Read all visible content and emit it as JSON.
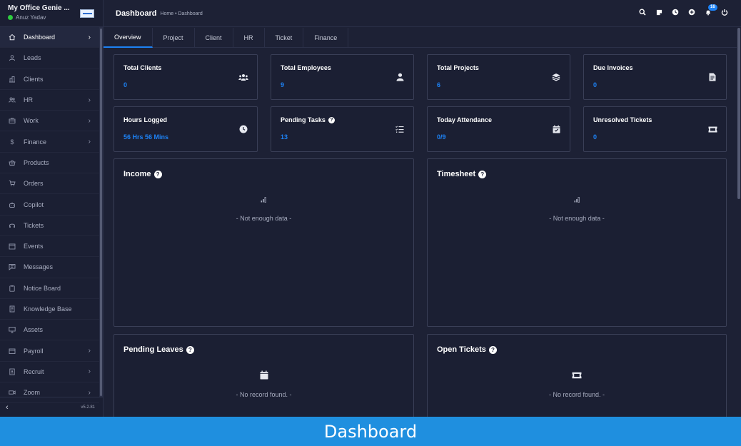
{
  "app": {
    "name": "My Office Genie ...",
    "user": "Anuz Yadav",
    "version": "v5.2.81"
  },
  "sidebar": {
    "items": [
      {
        "label": "Dashboard",
        "icon": "home-icon",
        "chevron": true,
        "active": true
      },
      {
        "label": "Leads",
        "icon": "user-icon",
        "chevron": false
      },
      {
        "label": "Clients",
        "icon": "building-icon",
        "chevron": false
      },
      {
        "label": "HR",
        "icon": "people-icon",
        "chevron": true
      },
      {
        "label": "Work",
        "icon": "briefcase-icon",
        "chevron": true
      },
      {
        "label": "Finance",
        "icon": "dollar-icon",
        "chevron": true
      },
      {
        "label": "Products",
        "icon": "basket-icon",
        "chevron": false
      },
      {
        "label": "Orders",
        "icon": "cart-icon",
        "chevron": false
      },
      {
        "label": "Copilot",
        "icon": "robot-icon",
        "chevron": false
      },
      {
        "label": "Tickets",
        "icon": "headset-icon",
        "chevron": false
      },
      {
        "label": "Events",
        "icon": "calendar-icon",
        "chevron": false
      },
      {
        "label": "Messages",
        "icon": "message-icon",
        "chevron": false
      },
      {
        "label": "Notice Board",
        "icon": "clipboard-icon",
        "chevron": false
      },
      {
        "label": "Knowledge Base",
        "icon": "book-icon",
        "chevron": false
      },
      {
        "label": "Assets",
        "icon": "monitor-icon",
        "chevron": false
      },
      {
        "label": "Payroll",
        "icon": "wallet-icon",
        "chevron": true
      },
      {
        "label": "Recruit",
        "icon": "badge-icon",
        "chevron": true
      },
      {
        "label": "Zoom",
        "icon": "video-icon",
        "chevron": true
      }
    ]
  },
  "header": {
    "title": "Dashboard",
    "breadcrumb": "Home • Dashboard",
    "notification_count": "16"
  },
  "tabs": [
    "Overview",
    "Project",
    "Client",
    "HR",
    "Ticket",
    "Finance"
  ],
  "stats": [
    {
      "label": "Total Clients",
      "value": "0",
      "icon": "users-icon"
    },
    {
      "label": "Total Employees",
      "value": "9",
      "icon": "user-icon"
    },
    {
      "label": "Total Projects",
      "value": "6",
      "icon": "layers-icon"
    },
    {
      "label": "Due Invoices",
      "value": "0",
      "icon": "file-invoice-icon"
    },
    {
      "label": "Hours Logged",
      "value": "56 Hrs 56 Mins",
      "icon": "clock-icon"
    },
    {
      "label": "Pending Tasks",
      "value": "13",
      "icon": "tasks-icon",
      "help": true
    },
    {
      "label": "Today Attendance",
      "value": "0/9",
      "icon": "calendar-check-icon"
    },
    {
      "label": "Unresolved Tickets",
      "value": "0",
      "icon": "ticket-icon"
    }
  ],
  "panels": {
    "income": {
      "title": "Income",
      "empty": "- Not enough data -"
    },
    "timesheet": {
      "title": "Timesheet",
      "empty": "- Not enough data -"
    },
    "pending_leaves": {
      "title": "Pending Leaves",
      "empty": "- No record found. -"
    },
    "open_tickets": {
      "title": "Open Tickets",
      "empty": "- No record found. -"
    }
  },
  "caption": "Dashboard",
  "colors": {
    "accent": "#1d82f5",
    "background": "#1d2135",
    "card": "#1b1f33",
    "caption_bar": "#1f8fdf"
  }
}
